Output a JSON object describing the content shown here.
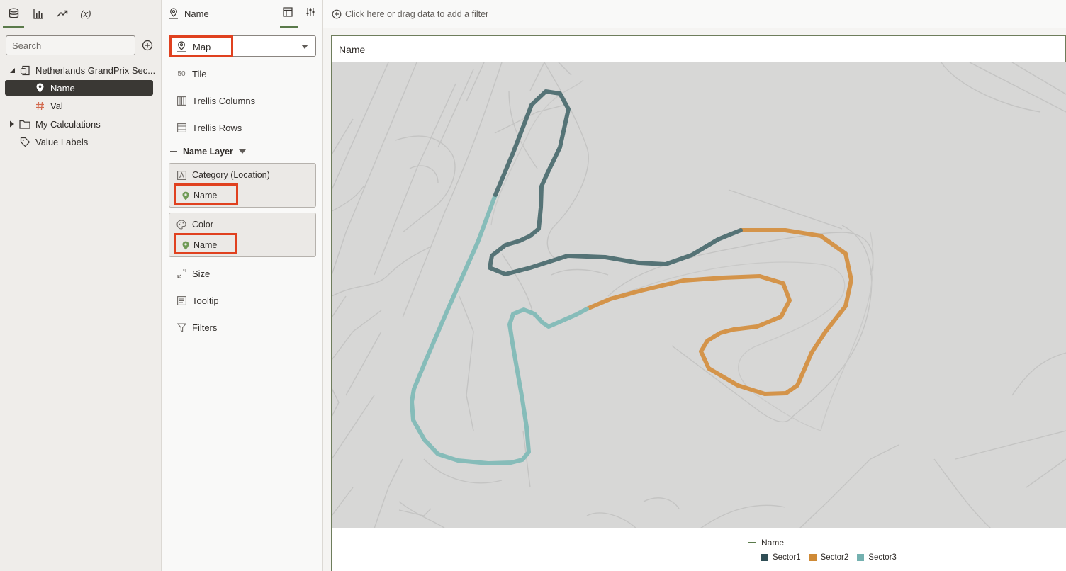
{
  "data_panel": {
    "search_placeholder": "Search",
    "tree": {
      "dataset": "Netherlands GrandPrix Sec...",
      "fields": [
        {
          "label": "Name",
          "type": "location"
        },
        {
          "label": "Val",
          "type": "measure"
        }
      ],
      "my_calculations": "My Calculations",
      "value_labels": "Value Labels"
    },
    "tabs": [
      "data-icon",
      "visualizations-icon",
      "analytics-icon",
      "calculation-icon"
    ],
    "calc_tab_label": "(x)"
  },
  "grammar_panel": {
    "header_title": "Name",
    "viz_type": "Map",
    "rows": {
      "tile": "Tile",
      "trellis_columns": "Trellis Columns",
      "trellis_rows": "Trellis Rows",
      "size": "Size",
      "tooltip": "Tooltip",
      "filters": "Filters"
    },
    "tile_icon_text": "50",
    "layer_title": "Name Layer",
    "category": {
      "label": "Category (Location)",
      "value": "Name"
    },
    "color": {
      "label": "Color",
      "value": "Name"
    }
  },
  "filter_bar": {
    "text": "Click here or drag data to add a filter"
  },
  "viz": {
    "title": "Name",
    "legend": {
      "title": "Name",
      "items": [
        {
          "label": "Sector1",
          "color": "#2f4e55"
        },
        {
          "label": "Sector2",
          "color": "#cf8a36"
        },
        {
          "label": "Sector3",
          "color": "#74b1b0"
        }
      ]
    }
  },
  "colors": {
    "accent": "#5a7a4a",
    "highlight": "#e0411f",
    "sector1_line": "#557376",
    "sector2_line": "#d4944a",
    "sector3_line": "#86bcb9",
    "map_bg": "#d7d7d6"
  }
}
